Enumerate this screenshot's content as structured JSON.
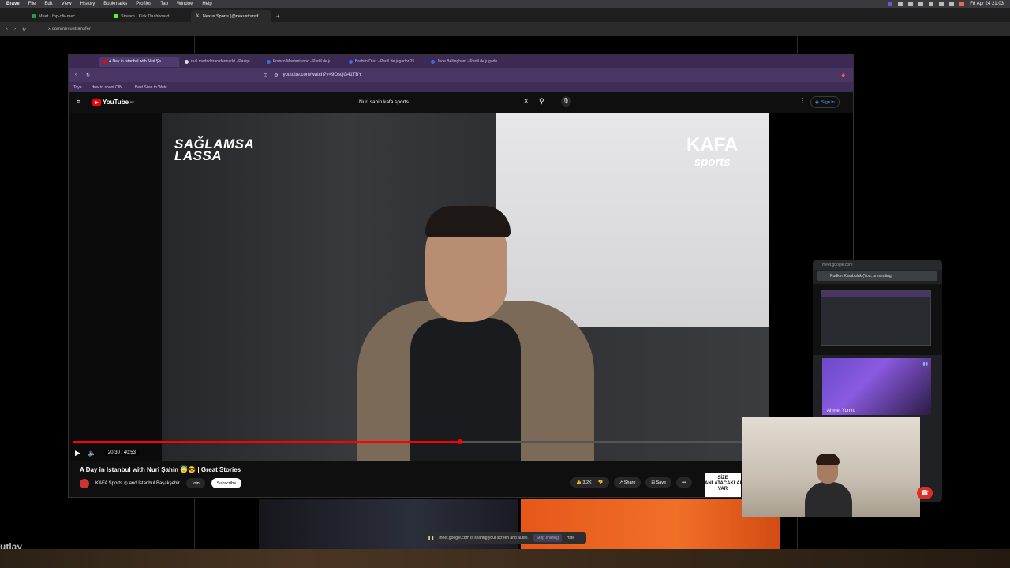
{
  "menubar": {
    "app": "Brave",
    "items": [
      "File",
      "Edit",
      "View",
      "History",
      "Bookmarks",
      "Profiles",
      "Tab",
      "Window",
      "Help"
    ],
    "clock": "Fri Apr 24  21:03"
  },
  "outer_browser": {
    "tabs": [
      {
        "label": "Meet - fbp-cfir-mec",
        "active": false
      },
      {
        "label": "Stream · Kick Dashboard",
        "active": false
      },
      {
        "label": "Nexus Sports (@nexustransf...",
        "active": true
      }
    ],
    "url": "x.com/nexustransfer"
  },
  "inner_browser": {
    "tabs": [
      {
        "label": "A Day in Istanbul with Nuri Şa...",
        "active": true,
        "color": "#ff0000"
      },
      {
        "label": "real madrid transfermarkt - Pasqu...",
        "active": false,
        "color": "#dddddd"
      },
      {
        "label": "Franco Mastantuono - Perfil de ju...",
        "active": false,
        "color": "#3b6fd6"
      },
      {
        "label": "Brahim Díaz - Perfil de jugador 25...",
        "active": false,
        "color": "#3b6fd6"
      },
      {
        "label": "Jude Bellingham - Perfil de jugado...",
        "active": false,
        "color": "#3b6fd6"
      }
    ],
    "url": "youtube.com/watch?v=9OscjG41TBY",
    "bookmarks": [
      "Toya",
      "How to shoot CIN...",
      "Best Sites to Watc..."
    ]
  },
  "youtube": {
    "logo": "YouTube",
    "region": "PT",
    "search_value": "Nuri sahin kafa sports",
    "sign_in": "Sign in",
    "video": {
      "brand_left": "SAĞLAMSA\nLASSA",
      "brand_right_top": "KAFA",
      "brand_right_bottom": "sports",
      "time": "20:30 / 40:53",
      "progress": 0.5
    },
    "title": "A Day in Istanbul with Nuri Şahin 😇😎 | Great Stories",
    "channel": "KAFA Sports ◎ and İstanbul Başakşehir",
    "join": "Join",
    "subscribe": "Subscribe",
    "likes": "3.2K",
    "share": "Share",
    "save": "Save",
    "ad_text": "SİZE\nANLATACAKLARIM\nVAR"
  },
  "meet": {
    "url": "meet.google.com",
    "presenting": "Rudker Karabulak (You, presenting)",
    "participant": "Ahmet Yumru",
    "share_notice": "meet.google.com is sharing your screen and audio.",
    "stop_sharing": "Stop sharing",
    "hide": "Hide"
  },
  "page_partial_text": "utlay",
  "colors": {
    "accent": "#ff0000",
    "inner_chrome": "#4a3664",
    "meet_bg": "#202124"
  }
}
